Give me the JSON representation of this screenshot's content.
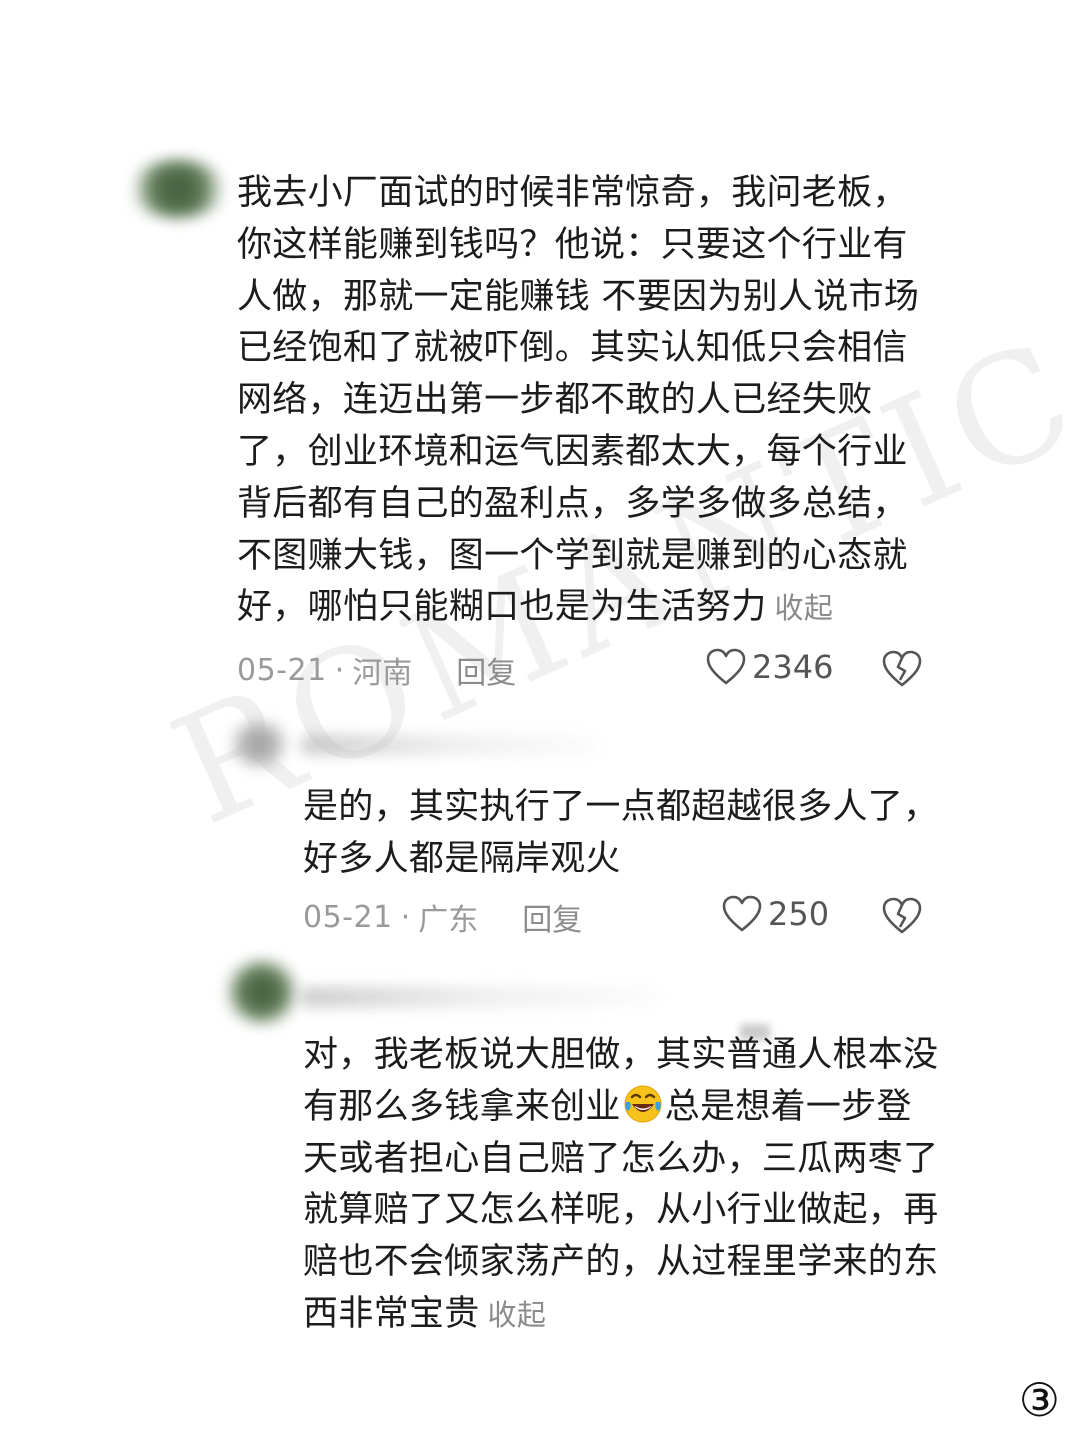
{
  "comments": [
    {
      "text": "我去小厂面试的时候非常惊奇，我问老板，你这样能赚到钱吗？他说：只要这个行业有人做，那就一定能赚钱 不要因为别人说市场已经饱和了就被吓倒。其实认知低只会相信网络，连迈出第一步都不敢的人已经失败了，创业环境和运气因素都太大，每个行业背后都有自己的盈利点，多学多做多总结，不图赚大钱，图一个学到就是赚到的心态就好，哪怕只能糊口也是为生活努力",
      "collapse_label": "收起",
      "date": "05-21",
      "separator": "·",
      "location": "河南",
      "reply_label": "回复",
      "likes": "2346"
    },
    {
      "text": "是的，其实执行了一点都超越很多人了，好多人都是隔岸观火",
      "date": "05-21",
      "separator": "·",
      "location": "广东",
      "reply_label": "回复",
      "likes": "250"
    },
    {
      "text_before_emoji": "对，我老板说大胆做，其实普通人根本没有那么多钱拿来创业",
      "emoji": "grinning-tears-emoji",
      "text_after_emoji": "总是想着一步登天或者担心自己赔了怎么办，三瓜两枣了就算赔了又怎么样呢，从小行业做起，再赔也不会倾家荡产的，从过程里学来的东西非常宝贵",
      "collapse_label": "收起"
    }
  ],
  "watermark": "ROMANTIC",
  "page_number": "③",
  "colors": {
    "text": "#1c1c1c",
    "meta": "#9a9a9a",
    "background": "#ffffff"
  }
}
